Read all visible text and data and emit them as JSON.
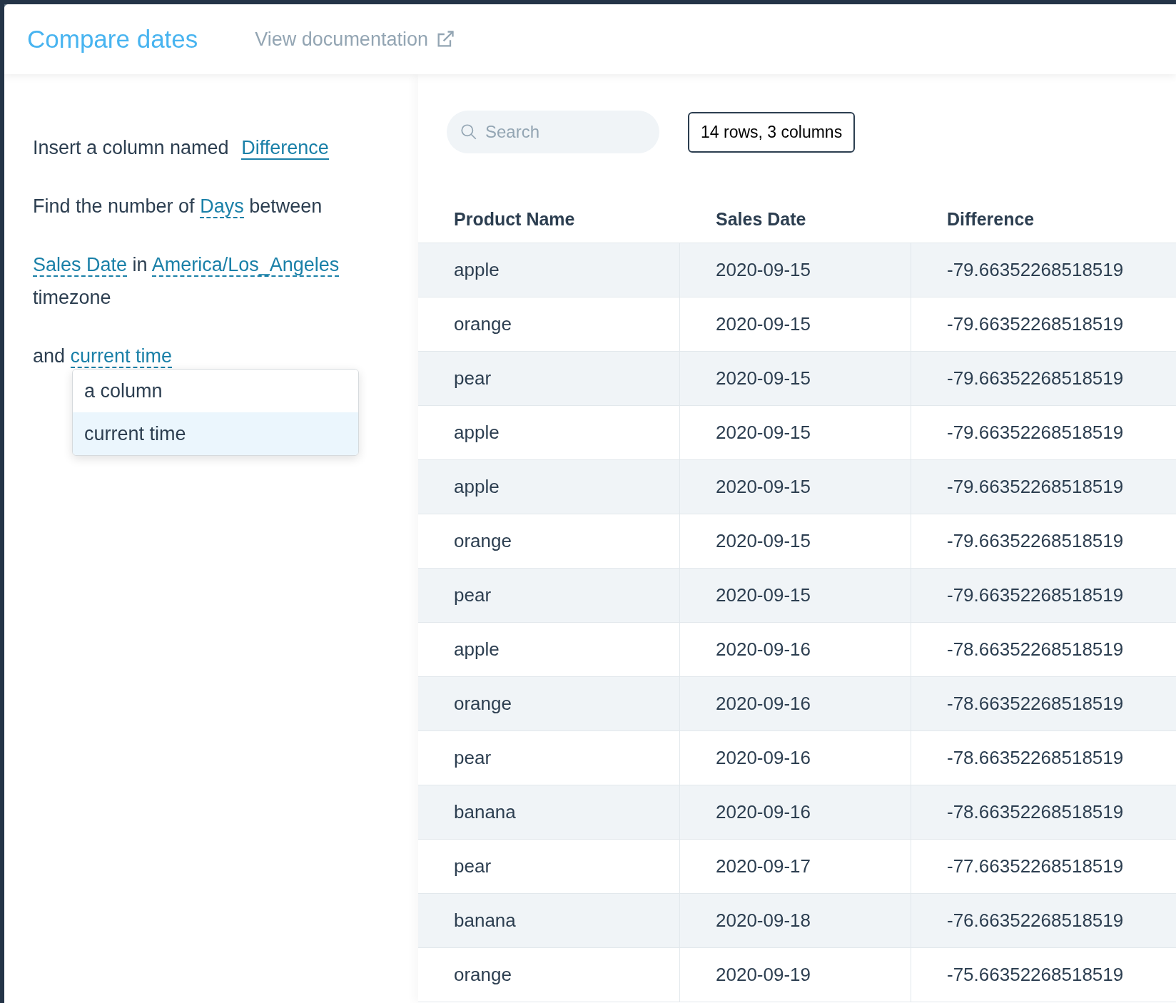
{
  "header": {
    "title": "Compare dates",
    "doc_link": "View documentation"
  },
  "form": {
    "paragraphs": [
      [
        {
          "kind": "plain",
          "text": "Insert a column named"
        },
        {
          "kind": "input",
          "text": "Difference"
        }
      ],
      [
        {
          "kind": "plain",
          "text": "Find the number of"
        },
        {
          "kind": "select",
          "text": "Days"
        },
        {
          "kind": "plain",
          "text": "between"
        }
      ],
      [
        {
          "kind": "select",
          "text": "Sales Date"
        },
        {
          "kind": "plain",
          "text": "in"
        },
        {
          "kind": "select",
          "text": "America/Los_Angeles"
        },
        {
          "kind": "plain",
          "text": "timezone"
        }
      ],
      [
        {
          "kind": "plain",
          "text": "and"
        },
        {
          "kind": "select",
          "text": "current time"
        }
      ]
    ],
    "dropdown": [
      {
        "label": "a column",
        "selected": false
      },
      {
        "label": "current time",
        "selected": true
      }
    ]
  },
  "toolbar": {
    "search": {
      "placeholder": "Search"
    },
    "summary": "14 rows, 3 columns"
  },
  "table": {
    "columns": [
      "Product Name",
      "Sales Date",
      "Difference"
    ],
    "rows": [
      [
        "apple",
        "2020-09-15",
        "-79.66352268518519"
      ],
      [
        "orange",
        "2020-09-15",
        "-79.66352268518519"
      ],
      [
        "pear",
        "2020-09-15",
        "-79.66352268518519"
      ],
      [
        "apple",
        "2020-09-15",
        "-79.66352268518519"
      ],
      [
        "apple",
        "2020-09-15",
        "-79.66352268518519"
      ],
      [
        "orange",
        "2020-09-15",
        "-79.66352268518519"
      ],
      [
        "pear",
        "2020-09-15",
        "-79.66352268518519"
      ],
      [
        "apple",
        "2020-09-16",
        "-78.66352268518519"
      ],
      [
        "orange",
        "2020-09-16",
        "-78.66352268518519"
      ],
      [
        "pear",
        "2020-09-16",
        "-78.66352268518519"
      ],
      [
        "banana",
        "2020-09-16",
        "-78.66352268518519"
      ],
      [
        "pear",
        "2020-09-17",
        "-77.66352268518519"
      ],
      [
        "banana",
        "2020-09-18",
        "-76.66352268518519"
      ],
      [
        "orange",
        "2020-09-19",
        "-75.66352268518519"
      ]
    ]
  }
}
